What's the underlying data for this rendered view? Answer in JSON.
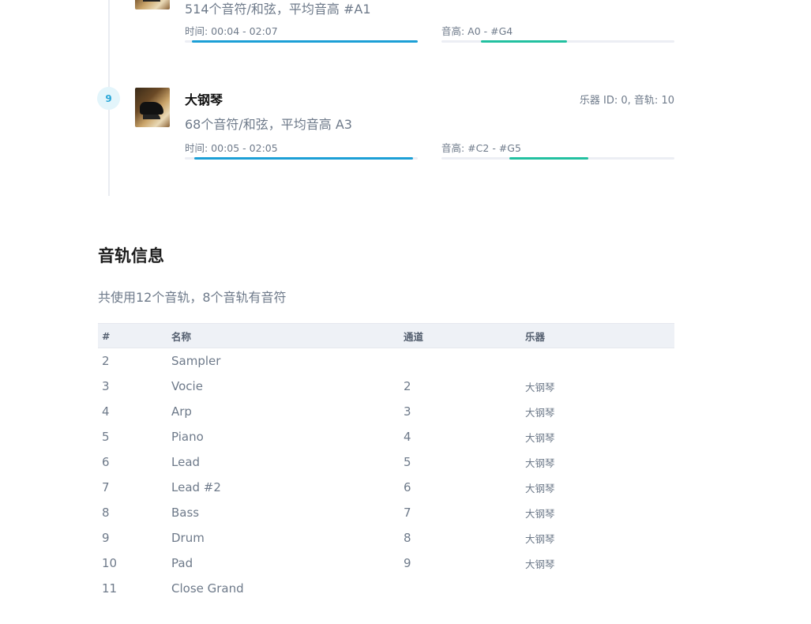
{
  "instruments": [
    {
      "index": "",
      "name": "",
      "meta": "",
      "summary": "514个音符/和弦，平均音高 #A1",
      "time_label": "时间: 00:04 - 02:07",
      "pitch_label": "音高: A0 - #G4",
      "time_range_fraction": [
        0.03,
        1.0
      ],
      "pitch_range_fraction": [
        0.17,
        0.54
      ]
    },
    {
      "index": "9",
      "name": "大钢琴",
      "meta": "乐器 ID: 0, 音轨: 10",
      "summary": "68个音符/和弦，平均音高 A3",
      "time_label": "时间: 00:05 - 02:05",
      "pitch_label": "音高: #C2 - #G5",
      "time_range_fraction": [
        0.04,
        0.98
      ],
      "pitch_range_fraction": [
        0.29,
        0.63
      ]
    }
  ],
  "track_section": {
    "title": "音轨信息",
    "description": "共使用12个音轨，8个音轨有音符",
    "headers": [
      "#",
      "名称",
      "通道",
      "乐器"
    ],
    "rows": [
      {
        "num": "2",
        "name": "Sampler",
        "channel": "",
        "instrument": ""
      },
      {
        "num": "3",
        "name": "Vocie",
        "channel": "2",
        "instrument": "大钢琴"
      },
      {
        "num": "4",
        "name": "Arp",
        "channel": "3",
        "instrument": "大钢琴"
      },
      {
        "num": "5",
        "name": "Piano",
        "channel": "4",
        "instrument": "大钢琴"
      },
      {
        "num": "6",
        "name": "Lead",
        "channel": "5",
        "instrument": "大钢琴"
      },
      {
        "num": "7",
        "name": "Lead #2",
        "channel": "6",
        "instrument": "大钢琴"
      },
      {
        "num": "8",
        "name": "Bass",
        "channel": "7",
        "instrument": "大钢琴"
      },
      {
        "num": "9",
        "name": "Drum",
        "channel": "8",
        "instrument": "大钢琴"
      },
      {
        "num": "10",
        "name": "Pad",
        "channel": "9",
        "instrument": "大钢琴"
      },
      {
        "num": "11",
        "name": "Close Grand",
        "channel": "",
        "instrument": ""
      }
    ]
  },
  "colors": {
    "time_bar": "#1c9fd6",
    "pitch_bar": "#22c0a0",
    "badge_bg": "#e3f5fb",
    "badge_text": "#2aa7d8"
  }
}
